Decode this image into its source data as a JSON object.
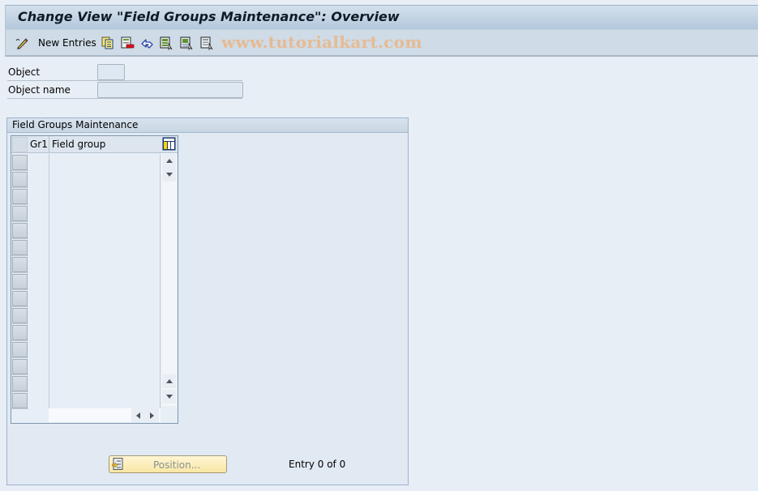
{
  "window": {
    "title": "Change View \"Field Groups Maintenance\": Overview"
  },
  "toolbar": {
    "items": [
      {
        "icon": "display-change-icon",
        "label": ""
      },
      {
        "icon": "new-entries-icon",
        "label": "New Entries"
      },
      {
        "icon": "copy-as-icon",
        "label": ""
      },
      {
        "icon": "delete-icon",
        "label": ""
      },
      {
        "icon": "undo-change-icon",
        "label": ""
      },
      {
        "icon": "select-all-icon",
        "label": ""
      },
      {
        "icon": "select-block-icon",
        "label": ""
      },
      {
        "icon": "deselect-all-icon",
        "label": ""
      }
    ],
    "new_entries_label": "New Entries",
    "watermark": "www.tutorialkart.com"
  },
  "header_fields": {
    "object": {
      "label": "Object",
      "value": ""
    },
    "object_name": {
      "label": "Object name",
      "value": ""
    }
  },
  "groupbox": {
    "title": "Field Groups Maintenance",
    "table": {
      "columns": [
        "Gr1",
        "Field group"
      ],
      "rows": [
        [
          "",
          ""
        ],
        [
          "",
          ""
        ],
        [
          "",
          ""
        ],
        [
          "",
          ""
        ],
        [
          "",
          ""
        ],
        [
          "",
          ""
        ],
        [
          "",
          ""
        ],
        [
          "",
          ""
        ],
        [
          "",
          ""
        ],
        [
          "",
          ""
        ],
        [
          "",
          ""
        ],
        [
          "",
          ""
        ],
        [
          "",
          ""
        ],
        [
          "",
          ""
        ],
        [
          "",
          ""
        ]
      ]
    },
    "position_button": "Position...",
    "entry_info": "Entry 0 of 0"
  },
  "colors": {
    "background": "#e8eef5",
    "titlebar": "#c3d4e4",
    "toolbar": "#cfdbe7",
    "watermark": "#e8b88a",
    "position_button": "#f8e7a4"
  }
}
